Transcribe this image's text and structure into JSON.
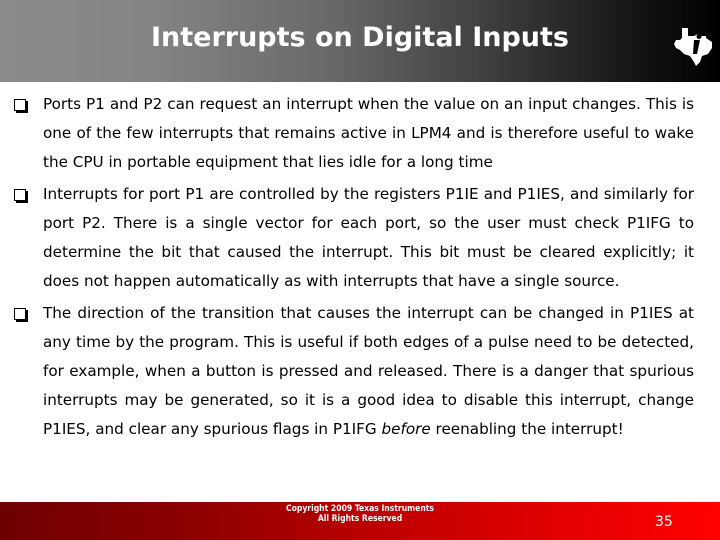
{
  "header": {
    "title": "Interrupts on Digital Inputs",
    "logo_icon": "texas-instruments-logo"
  },
  "bullets": [
    {
      "icon": "checkbox-bullet",
      "text": "Ports P1 and P2 can request an interrupt when the value on an input changes. This is one of the few interrupts that remains active in LPM4 and is therefore useful to wake the CPU in portable equipment that lies idle for a long time"
    },
    {
      "icon": "checkbox-bullet",
      "text": "Interrupts for port P1 are controlled by the registers P1IE and P1IES, and similarly for port P2. There is a single vector for each port, so the user must check P1IFG to determine the bit that caused the interrupt. This bit must be cleared explicitly; it does not happen automatically as with interrupts that have a single source."
    },
    {
      "icon": "checkbox-bullet",
      "text_before": "The direction of the transition that causes the interrupt can be changed in P1IES at any time by the program. This is useful if both edges of a pulse need to be detected, for example, when a button is pressed and released. There is a danger that spurious interrupts may be generated, so it is a good idea to disable this interrupt, change P1IES, and clear any spurious flags in P1IFG ",
      "text_italic": "before",
      "text_after": " reenabling the interrupt!"
    }
  ],
  "footer": {
    "copyright_line1": "Copyright 2009 Texas Instruments",
    "copyright_line2": "All Rights Reserved",
    "page_number": "35"
  },
  "colors": {
    "header_gradient_start": "#8a8a8a",
    "header_gradient_end": "#000000",
    "footer_gradient_start": "#6e0000",
    "footer_gradient_end": "#ff0000"
  }
}
